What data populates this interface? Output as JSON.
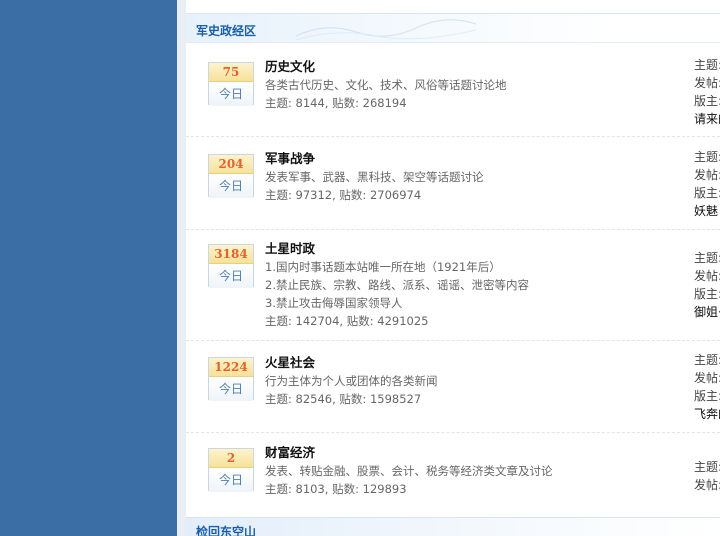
{
  "section": {
    "title": "军史政经区"
  },
  "next_section": {
    "title": "检回东空山"
  },
  "forums": [
    {
      "today_count": "75",
      "today_label": "今日",
      "name": "历史文化",
      "description_lines": [
        "各类古代历史、文化、技术、风俗等话题讨论地"
      ],
      "stats": "主题: 8144, 贴数: 268194",
      "meta": [
        "主题:",
        "发帖:",
        "版主:",
        "请来的"
      ]
    },
    {
      "today_count": "204",
      "today_label": "今日",
      "name": "军事战争",
      "description_lines": [
        "发表军事、武器、黑科技、架空等话题讨论"
      ],
      "stats": "主题: 97312, 贴数: 2706974",
      "meta": [
        "主题:",
        "发帖:",
        "版主:",
        "妖魅"
      ]
    },
    {
      "today_count": "3184",
      "today_label": "今日",
      "name": "土星时政",
      "description_lines": [
        "1.国内时事话题本站唯一所在地（1921年后）",
        "2.禁止民族、宗教、路线、派系、谣谣、泄密等内容",
        "3.禁止攻击侮辱国家领导人"
      ],
      "stats": "主题: 142704, 贴数: 4291025",
      "meta": [
        "主题:",
        "发帖:",
        "版主:",
        "御姐·"
      ]
    },
    {
      "today_count": "1224",
      "today_label": "今日",
      "name": "火星社会",
      "description_lines": [
        "行为主体为个人或团体的各类新闻"
      ],
      "stats": "主题: 82546, 贴数: 1598527",
      "meta": [
        "主题:",
        "发帖:",
        "版主:",
        "飞奔的"
      ]
    },
    {
      "today_count": "2",
      "today_label": "今日",
      "name": "财富经济",
      "description_lines": [
        "发表、转贴金融、股票、会计、税务等经济类文章及讨论"
      ],
      "stats": "主题: 8103, 贴数: 129893",
      "meta": [
        "主题:",
        "发帖:"
      ]
    }
  ]
}
